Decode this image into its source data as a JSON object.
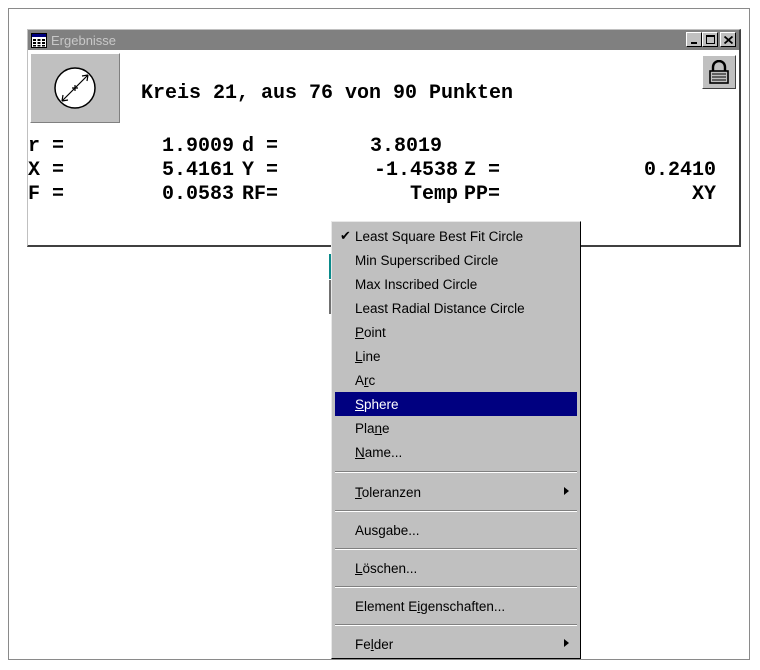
{
  "window": {
    "title": "Ergebnisse",
    "minimize": "_",
    "maximize": "□",
    "close": "×"
  },
  "result": {
    "heading": "Kreis 21, aus 76 von 90 Punkten",
    "rows": [
      [
        {
          "label": "r =",
          "value": "1.9009"
        },
        {
          "label": "d =",
          "value": "3.8019"
        },
        {
          "label": "",
          "value": ""
        }
      ],
      [
        {
          "label": "X =",
          "value": "5.4161"
        },
        {
          "label": "Y =",
          "value": "-1.4538"
        },
        {
          "label": "Z =",
          "value": "0.2410"
        }
      ],
      [
        {
          "label": "F =",
          "value": "0.0583"
        },
        {
          "label": "RF=",
          "value": "Temp"
        },
        {
          "label": "PP=",
          "value": "XY"
        }
      ]
    ]
  },
  "menu": {
    "items": [
      {
        "label": "Least Square Best Fit Circle",
        "checked": true
      },
      {
        "label": "Min Superscribed Circle"
      },
      {
        "label": "Max Inscribed Circle"
      },
      {
        "label": "Least Radial Distance Circle"
      },
      {
        "label": "Point",
        "mnemonic": "P"
      },
      {
        "label": "Line",
        "mnemonic": "L"
      },
      {
        "label": "Arc",
        "mnemonic": "r"
      },
      {
        "label": "Sphere",
        "mnemonic": "S",
        "highlighted": true
      },
      {
        "label": "Plane",
        "mnemonic": "n"
      },
      {
        "label": "Name...",
        "mnemonic": "N"
      },
      {
        "label": "Toleranzen",
        "mnemonic": "T",
        "submenu": true
      },
      {
        "label": "Ausgabe...",
        "mnemonic": "g"
      },
      {
        "label": "Löschen...",
        "mnemonic": "L"
      },
      {
        "label": "Element Eigenschaften...",
        "mnemonic": "i"
      },
      {
        "label": "Felder",
        "mnemonic": "l",
        "submenu": true
      }
    ]
  },
  "colors": {
    "highlight": "#000080",
    "face": "#c0c0c0",
    "titlebar_inactive": "#808080"
  }
}
